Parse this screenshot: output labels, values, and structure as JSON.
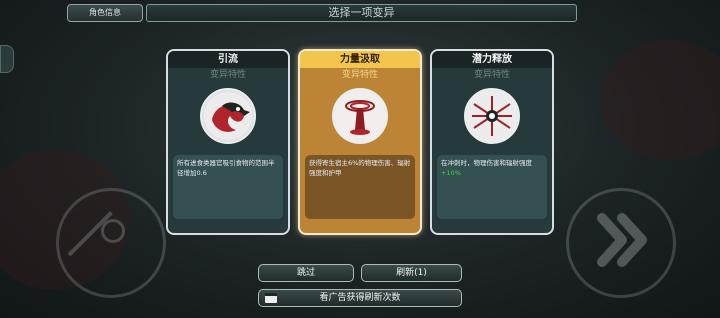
{
  "header": {
    "char_info_label": "角色信息",
    "title": "选择一项变异"
  },
  "cards": [
    {
      "name": "引流",
      "trait": "变异特性",
      "icon": "crow-hook-icon",
      "desc": "所有进食类器官吸引食物的范围半径增加0.6",
      "highlight": ""
    },
    {
      "name": "力量汲取",
      "trait": "变异特性",
      "icon": "blood-drain-icon",
      "desc": "获得寄生宿主6%的物理伤害、辐射强度和护甲",
      "highlight": ""
    },
    {
      "name": "潜力释放",
      "trait": "变异特性",
      "icon": "burst-icon",
      "desc": "在冲刺时，物理伤害和辐射强度",
      "highlight": "+10%"
    }
  ],
  "buttons": {
    "skip": "跳过",
    "refresh": "刷新(1)",
    "watch_ad": "看广告获得刷新次数"
  },
  "colors": {
    "selected_header": "#f2c54e",
    "selected_body": "#bc8434",
    "card_body": "#26393b",
    "highlight_green": "#32d94e"
  }
}
